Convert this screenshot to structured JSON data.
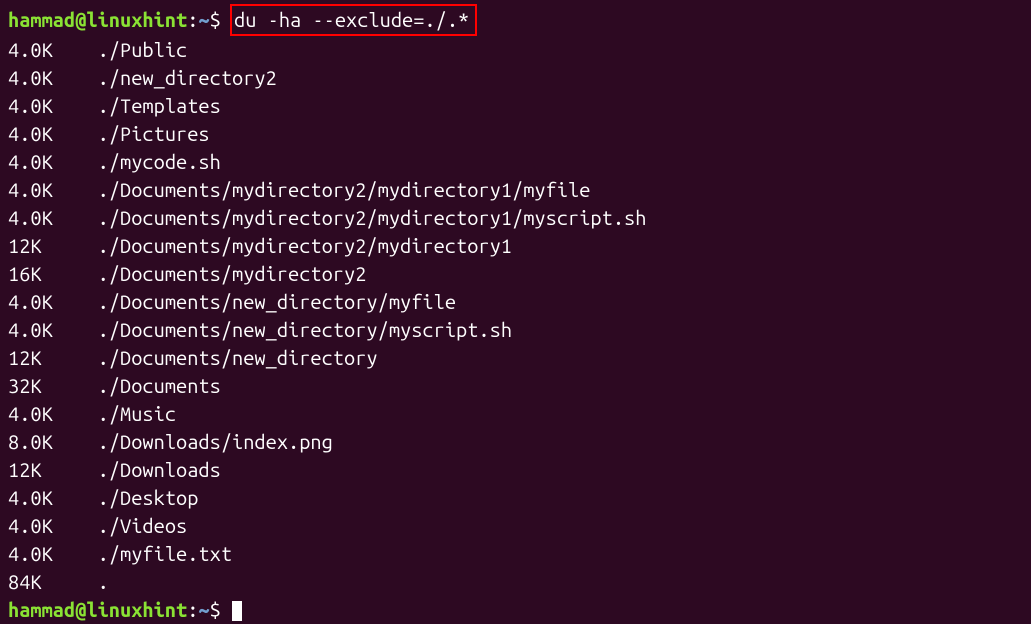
{
  "prompt": {
    "user": "hammad@linuxhint",
    "colon": ":",
    "path": "~",
    "dollar": "$"
  },
  "command": "du -ha --exclude=./.*",
  "output": [
    {
      "size": "4.0K",
      "path": "./Public"
    },
    {
      "size": "4.0K",
      "path": "./new_directory2"
    },
    {
      "size": "4.0K",
      "path": "./Templates"
    },
    {
      "size": "4.0K",
      "path": "./Pictures"
    },
    {
      "size": "4.0K",
      "path": "./mycode.sh"
    },
    {
      "size": "4.0K",
      "path": "./Documents/mydirectory2/mydirectory1/myfile"
    },
    {
      "size": "4.0K",
      "path": "./Documents/mydirectory2/mydirectory1/myscript.sh"
    },
    {
      "size": "12K",
      "path": "./Documents/mydirectory2/mydirectory1"
    },
    {
      "size": "16K",
      "path": "./Documents/mydirectory2"
    },
    {
      "size": "4.0K",
      "path": "./Documents/new_directory/myfile"
    },
    {
      "size": "4.0K",
      "path": "./Documents/new_directory/myscript.sh"
    },
    {
      "size": "12K",
      "path": "./Documents/new_directory"
    },
    {
      "size": "32K",
      "path": "./Documents"
    },
    {
      "size": "4.0K",
      "path": "./Music"
    },
    {
      "size": "8.0K",
      "path": "./Downloads/index.png"
    },
    {
      "size": "12K",
      "path": "./Downloads"
    },
    {
      "size": "4.0K",
      "path": "./Desktop"
    },
    {
      "size": "4.0K",
      "path": "./Videos"
    },
    {
      "size": "4.0K",
      "path": "./myfile.txt"
    },
    {
      "size": "84K",
      "path": "."
    }
  ]
}
